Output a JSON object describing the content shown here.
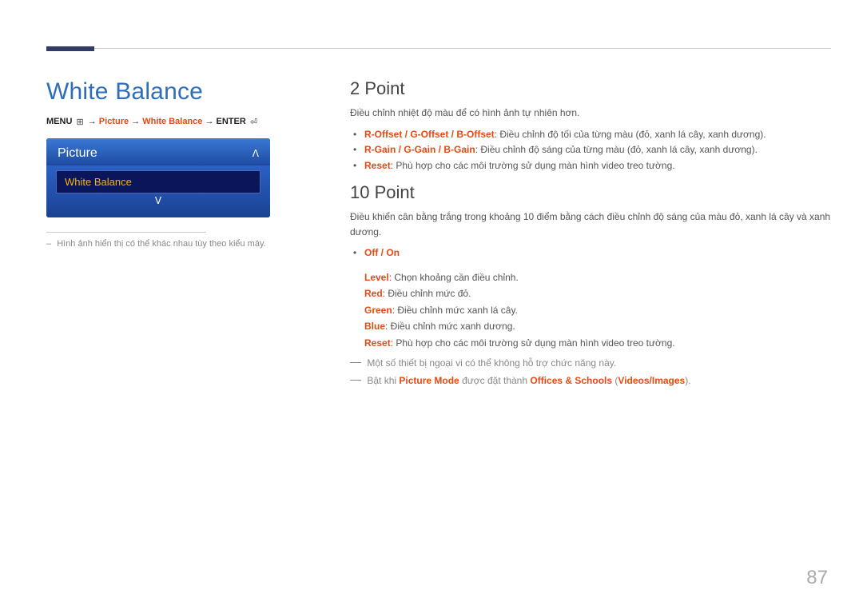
{
  "page": {
    "number": "87",
    "section_title": "White Balance"
  },
  "menu_path": {
    "menu": "MENU",
    "picture": "Picture",
    "whitebalance": "White Balance",
    "enter": "ENTER"
  },
  "icons": {
    "menu": "⊞",
    "enter": "⏎",
    "up": "ᐱ",
    "down": "ᐯ",
    "arrow": "→"
  },
  "osd": {
    "title": "Picture",
    "selected": "White Balance"
  },
  "left_note": "Hình ảnh hiển thị có thể khác nhau tùy theo kiểu máy.",
  "right": {
    "two_point": {
      "heading": "2 Point",
      "intro": "Điều chỉnh nhiệt độ màu để có hình ảnh tự nhiên hơn.",
      "items": [
        {
          "label": "R-Offset / G-Offset / B-Offset",
          "desc": ": Điều chỉnh độ tối của từng màu (đỏ, xanh lá cây, xanh dương)."
        },
        {
          "label": "R-Gain / G-Gain / B-Gain",
          "desc": ": Điều chỉnh độ sáng của từng màu (đỏ, xanh lá cây, xanh dương)."
        },
        {
          "label": "Reset",
          "desc": ": Phù hợp cho các môi trường sử dụng màn hình video treo tường."
        }
      ]
    },
    "ten_point": {
      "heading": "10 Point",
      "intro": "Điều khiển cân bằng trắng trong khoảng 10 điểm bằng cách điều chỉnh độ sáng của màu đỏ, xanh lá cây và xanh dương.",
      "off_on": "Off / On",
      "defs": [
        {
          "label": "Level",
          "desc": ": Chọn khoảng cần điều chỉnh."
        },
        {
          "label": "Red",
          "desc": ": Điều chỉnh mức đỏ."
        },
        {
          "label": "Green",
          "desc": ": Điều chỉnh mức xanh lá cây."
        },
        {
          "label": "Blue",
          "desc": ": Điều chỉnh mức xanh dương."
        },
        {
          "label": "Reset",
          "desc": ": Phù hợp cho các môi trường sử dụng màn hình video treo tường."
        }
      ],
      "notes": {
        "n1": "Một số thiết bị ngoại vi có thể không hỗ trợ chức năng này.",
        "n2_pre": "Bật khi ",
        "n2_pm": "Picture Mode",
        "n2_mid": " được đặt thành ",
        "n2_os": "Offices & Schools",
        "n2_paren_open": " (",
        "n2_vi": "Videos/Images",
        "n2_paren_close": ")."
      }
    }
  }
}
